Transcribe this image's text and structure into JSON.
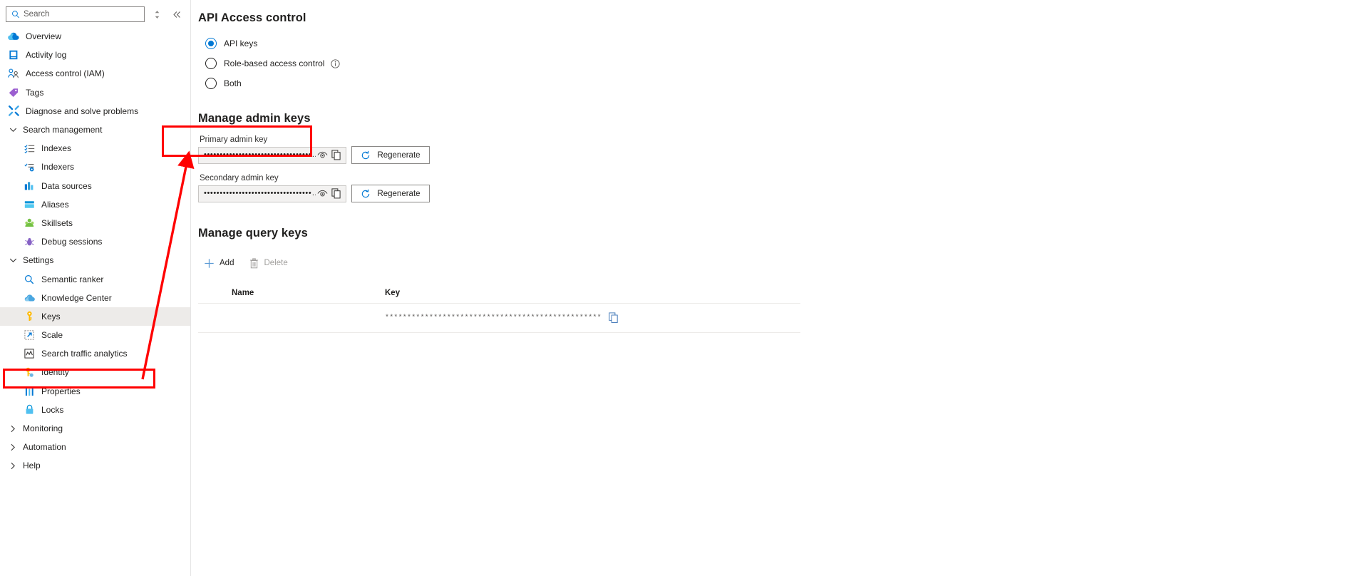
{
  "sidebar": {
    "search": {
      "placeholder": "Search",
      "value": "",
      "icon": "search-icon"
    },
    "tools": [
      {
        "name": "sort-toggle-icon",
        "glyph": "⇅"
      },
      {
        "name": "collapse-pane-icon",
        "glyph": "«"
      }
    ],
    "items": [
      {
        "label": "Overview",
        "icon": "cloud-icon",
        "level": 1,
        "type": "link",
        "selected": false
      },
      {
        "label": "Activity log",
        "icon": "activity-log-icon",
        "level": 1,
        "type": "link",
        "selected": false
      },
      {
        "label": "Access control (IAM)",
        "icon": "access-control-icon",
        "level": 1,
        "type": "link",
        "selected": false
      },
      {
        "label": "Tags",
        "icon": "tag-icon",
        "level": 1,
        "type": "link",
        "selected": false
      },
      {
        "label": "Diagnose and solve problems",
        "icon": "wrench-icon",
        "level": 1,
        "type": "link",
        "selected": false
      },
      {
        "label": "Search management",
        "icon": "chevron-down-icon",
        "level": 1,
        "type": "group-expanded",
        "selected": false
      },
      {
        "label": "Indexes",
        "icon": "indexes-icon",
        "level": 2,
        "type": "link",
        "selected": false
      },
      {
        "label": "Indexers",
        "icon": "indexers-icon",
        "level": 2,
        "type": "link",
        "selected": false
      },
      {
        "label": "Data sources",
        "icon": "data-sources-icon",
        "level": 2,
        "type": "link",
        "selected": false
      },
      {
        "label": "Aliases",
        "icon": "aliases-icon",
        "level": 2,
        "type": "link",
        "selected": false
      },
      {
        "label": "Skillsets",
        "icon": "skillsets-icon",
        "level": 2,
        "type": "link",
        "selected": false
      },
      {
        "label": "Debug sessions",
        "icon": "debug-sessions-icon",
        "level": 2,
        "type": "link",
        "selected": false
      },
      {
        "label": "Settings",
        "icon": "chevron-down-icon",
        "level": 1,
        "type": "group-expanded",
        "selected": false
      },
      {
        "label": "Semantic ranker",
        "icon": "magnifier-icon",
        "level": 2,
        "type": "link",
        "selected": false
      },
      {
        "label": "Knowledge Center",
        "icon": "knowledge-center-icon",
        "level": 2,
        "type": "link",
        "selected": false
      },
      {
        "label": "Keys",
        "icon": "key-icon",
        "level": 2,
        "type": "link",
        "selected": true
      },
      {
        "label": "Scale",
        "icon": "scale-icon",
        "level": 2,
        "type": "link",
        "selected": false
      },
      {
        "label": "Search traffic analytics",
        "icon": "analytics-icon",
        "level": 2,
        "type": "link",
        "selected": false
      },
      {
        "label": "Identity",
        "icon": "identity-key-icon",
        "level": 2,
        "type": "link",
        "selected": false
      },
      {
        "label": "Properties",
        "icon": "properties-icon",
        "level": 2,
        "type": "link",
        "selected": false
      },
      {
        "label": "Locks",
        "icon": "lock-icon",
        "level": 2,
        "type": "link",
        "selected": false
      },
      {
        "label": "Monitoring",
        "icon": "chevron-right-icon",
        "level": 1,
        "type": "group-collapsed",
        "selected": false
      },
      {
        "label": "Automation",
        "icon": "chevron-right-icon",
        "level": 1,
        "type": "group-collapsed",
        "selected": false
      },
      {
        "label": "Help",
        "icon": "chevron-right-icon",
        "level": 1,
        "type": "group-collapsed",
        "selected": false
      }
    ]
  },
  "main": {
    "access_control": {
      "title": "API Access control",
      "options": [
        {
          "label": "API keys",
          "selected": true,
          "has_info": false
        },
        {
          "label": "Role-based access control",
          "selected": false,
          "has_info": true
        },
        {
          "label": "Both",
          "selected": false,
          "has_info": false
        }
      ]
    },
    "admin_keys": {
      "title": "Manage admin keys",
      "primary": {
        "label": "Primary admin key",
        "masked_value": "••••••••••••••••••••••••••••••••••…",
        "reveal_icon": "eye-icon",
        "copy_icon": "copy-icon",
        "regenerate_label": "Regenerate",
        "regenerate_icon": "refresh-icon"
      },
      "secondary": {
        "label": "Secondary admin key",
        "masked_value": "••••••••••••••••••••••••••••••••••…",
        "reveal_icon": "eye-icon",
        "copy_icon": "copy-icon",
        "regenerate_label": "Regenerate",
        "regenerate_icon": "refresh-icon"
      }
    },
    "query_keys": {
      "title": "Manage query keys",
      "commands": [
        {
          "label": "Add",
          "icon": "plus-icon",
          "disabled": false
        },
        {
          "label": "Delete",
          "icon": "trash-icon",
          "disabled": true
        }
      ],
      "columns": [
        "Name",
        "Key"
      ],
      "rows": [
        {
          "name": "",
          "key": "*************************************************",
          "copy_icon": "copy-icon"
        }
      ]
    }
  },
  "annotations": {
    "color": "#ff0000",
    "shapes": [
      {
        "name": "highlight-box-keys-nav",
        "type": "rect"
      },
      {
        "name": "highlight-box-primary-key",
        "type": "rect"
      },
      {
        "name": "pointer-arrow-keys-to-primary",
        "type": "arrow"
      }
    ]
  }
}
